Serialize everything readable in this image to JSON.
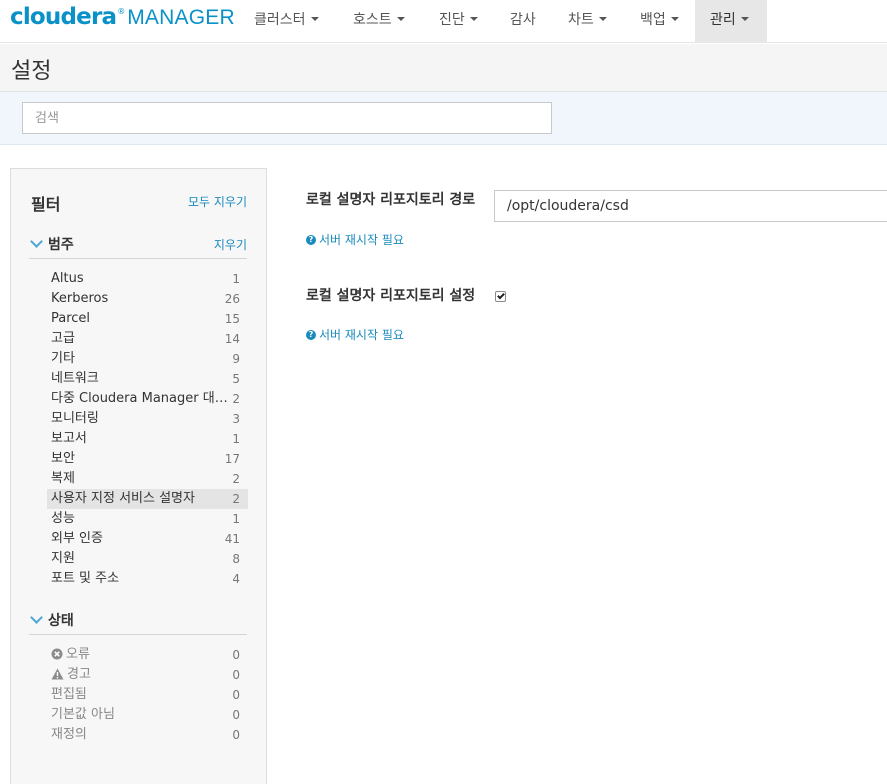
{
  "brand": {
    "name": "cloudera",
    "product": "MANAGER"
  },
  "nav": [
    {
      "label": "클러스터",
      "dropdown": true
    },
    {
      "label": "호스트",
      "dropdown": true
    },
    {
      "label": "진단",
      "dropdown": true
    },
    {
      "label": "감사",
      "dropdown": false
    },
    {
      "label": "차트",
      "dropdown": true
    },
    {
      "label": "백업",
      "dropdown": true
    },
    {
      "label": "관리",
      "dropdown": true,
      "active": true
    }
  ],
  "page": {
    "title": "설정"
  },
  "search": {
    "placeholder": "검색",
    "value": ""
  },
  "filter": {
    "title": "필터",
    "clear_all": "모두 지우기",
    "category": {
      "title": "범주",
      "clear": "지우기",
      "items": [
        {
          "label": "Altus",
          "count": "1"
        },
        {
          "label": "Kerberos",
          "count": "26"
        },
        {
          "label": "Parcel",
          "count": "15"
        },
        {
          "label": "고급",
          "count": "14"
        },
        {
          "label": "기타",
          "count": "9"
        },
        {
          "label": "네트워크",
          "count": "5"
        },
        {
          "label": "다중 Cloudera Manager 대시보드",
          "count": "2"
        },
        {
          "label": "모니터링",
          "count": "3"
        },
        {
          "label": "보고서",
          "count": "1"
        },
        {
          "label": "보안",
          "count": "17"
        },
        {
          "label": "복제",
          "count": "2"
        },
        {
          "label": "사용자 지정 서비스 설명자",
          "count": "2",
          "selected": true
        },
        {
          "label": "성능",
          "count": "1"
        },
        {
          "label": "외부 인증",
          "count": "41"
        },
        {
          "label": "지원",
          "count": "8"
        },
        {
          "label": "포트 및 주소",
          "count": "4"
        }
      ]
    },
    "status": {
      "title": "상태",
      "items": [
        {
          "label": "오류",
          "count": "0",
          "icon": "error-icon"
        },
        {
          "label": "경고",
          "count": "0",
          "icon": "warning-icon"
        },
        {
          "label": "편집됨",
          "count": "0"
        },
        {
          "label": "기본값 아님",
          "count": "0"
        },
        {
          "label": "재정의",
          "count": "0"
        }
      ]
    }
  },
  "settings": [
    {
      "label": "로컬 설명자 리포지토리 경로",
      "note": "서버 재시작 필요",
      "type": "text",
      "value": "/opt/cloudera/csd"
    },
    {
      "label": "로컬 설명자 리포지토리 설정",
      "note": "서버 재시작 필요",
      "type": "checkbox",
      "checked": true
    }
  ],
  "colors": {
    "brand": "#0a91c8",
    "link": "#1a8bbd",
    "nav_active_bg": "#e7e7e7",
    "search_band_bg": "#f0f6fb"
  }
}
